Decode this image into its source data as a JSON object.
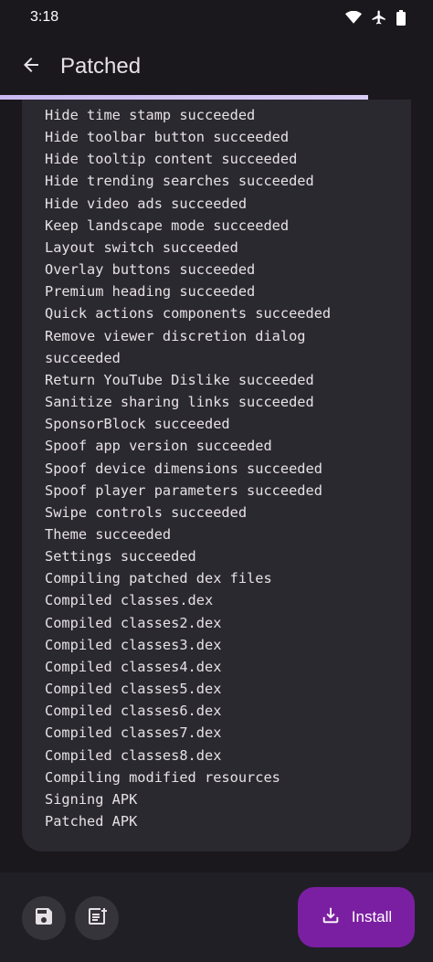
{
  "status_bar": {
    "time": "3:18",
    "icons": [
      "wifi-icon",
      "airplane-icon",
      "battery-icon"
    ]
  },
  "header": {
    "title": "Patched",
    "back_icon": "arrow-back-icon"
  },
  "progress": {
    "value_fraction": 0.85
  },
  "log": {
    "lines": [
      "Hide time stamp succeeded",
      "Hide toolbar button succeeded",
      "Hide tooltip content succeeded",
      "Hide trending searches succeeded",
      "Hide video ads succeeded",
      "Keep landscape mode succeeded",
      "Layout switch succeeded",
      "Overlay buttons succeeded",
      "Premium heading succeeded",
      "Quick actions components succeeded",
      "Remove viewer discretion dialog succeeded",
      "Return YouTube Dislike succeeded",
      "Sanitize sharing links succeeded",
      "SponsorBlock succeeded",
      "Spoof app version succeeded",
      "Spoof device dimensions succeeded",
      "Spoof player parameters succeeded",
      "Swipe controls succeeded",
      "Theme succeeded",
      "Settings succeeded",
      "Compiling patched dex files",
      "Compiled classes.dex",
      "Compiled classes2.dex",
      "Compiled classes3.dex",
      "Compiled classes4.dex",
      "Compiled classes5.dex",
      "Compiled classes6.dex",
      "Compiled classes7.dex",
      "Compiled classes8.dex",
      "Compiling modified resources",
      "Signing APK",
      "Patched APK"
    ]
  },
  "bottom_bar": {
    "save_icon": "save-icon",
    "log_icon": "note-add-icon",
    "install_label": "Install",
    "install_icon": "download-icon"
  },
  "colors": {
    "background": "#1a181d",
    "card": "#2b2930",
    "accent": "#7b1fa2",
    "progress": "#d0c2f2"
  }
}
